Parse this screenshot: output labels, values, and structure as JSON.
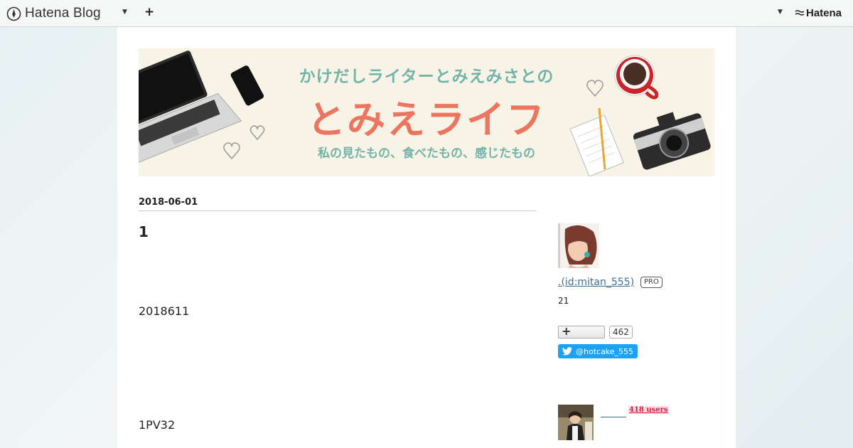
{
  "global_header": {
    "logo_text": "Hatena Blog",
    "hatena_text": "Hatena"
  },
  "banner": {
    "line1": "かけだしライターとみえみさとの",
    "line2": "とみえライフ",
    "line3": "私の見たもの、食べたもの、感じたもの"
  },
  "article": {
    "date": "2018-06-01",
    "title": "1",
    "paragraph1": "2018611",
    "paragraph2": "1PV32"
  },
  "sidebar": {
    "profile_link": ".(id:mitan_555)",
    "pro_badge": "PRO",
    "subscriber_text": "21",
    "subscribe_count": "462",
    "twitter_handle": "@hotcake_555",
    "users_badge": "418 users"
  },
  "colors": {
    "twitter_blue": "#1da1f2",
    "banner_coral": "#ec7560",
    "banner_teal": "#73b3a8",
    "link_blue": "#3d6e96"
  }
}
